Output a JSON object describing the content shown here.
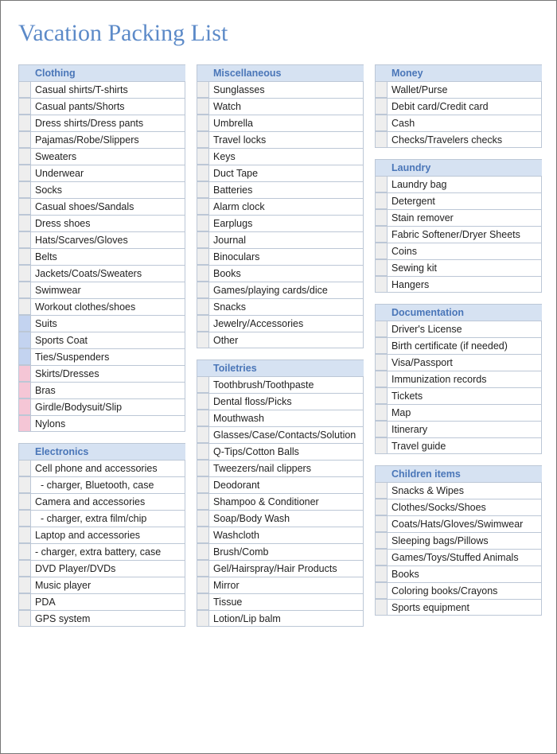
{
  "title": "Vacation Packing List",
  "columns": [
    [
      {
        "header": "Clothing",
        "items": [
          {
            "label": "Casual shirts/T-shirts",
            "color": "grey"
          },
          {
            "label": "Casual pants/Shorts",
            "color": "grey"
          },
          {
            "label": "Dress shirts/Dress pants",
            "color": "grey"
          },
          {
            "label": "Pajamas/Robe/Slippers",
            "color": "grey"
          },
          {
            "label": "Sweaters",
            "color": "grey"
          },
          {
            "label": "Underwear",
            "color": "grey"
          },
          {
            "label": "Socks",
            "color": "grey"
          },
          {
            "label": "Casual shoes/Sandals",
            "color": "grey"
          },
          {
            "label": "Dress shoes",
            "color": "grey"
          },
          {
            "label": "Hats/Scarves/Gloves",
            "color": "grey"
          },
          {
            "label": "Belts",
            "color": "grey"
          },
          {
            "label": "Jackets/Coats/Sweaters",
            "color": "grey"
          },
          {
            "label": "Swimwear",
            "color": "grey"
          },
          {
            "label": "Workout clothes/shoes",
            "color": "grey"
          },
          {
            "label": "Suits",
            "color": "blue"
          },
          {
            "label": "Sports Coat",
            "color": "blue"
          },
          {
            "label": "Ties/Suspenders",
            "color": "blue"
          },
          {
            "label": "Skirts/Dresses",
            "color": "pink"
          },
          {
            "label": "Bras",
            "color": "pink"
          },
          {
            "label": "Girdle/Bodysuit/Slip",
            "color": "pink"
          },
          {
            "label": "Nylons",
            "color": "pink"
          }
        ]
      },
      {
        "header": "Electronics",
        "items": [
          {
            "label": "Cell phone and accessories",
            "color": "grey"
          },
          {
            "label": "  - charger, Bluetooth, case",
            "color": "grey"
          },
          {
            "label": "Camera and accessories",
            "color": "grey"
          },
          {
            "label": "  - charger, extra film/chip",
            "color": "grey"
          },
          {
            "label": "Laptop and accessories",
            "color": "grey"
          },
          {
            "label": "- charger, extra battery, case",
            "color": "grey"
          },
          {
            "label": "DVD Player/DVDs",
            "color": "grey"
          },
          {
            "label": "Music player",
            "color": "grey"
          },
          {
            "label": "PDA",
            "color": "grey"
          },
          {
            "label": "GPS system",
            "color": "grey"
          }
        ]
      }
    ],
    [
      {
        "header": "Miscellaneous",
        "items": [
          {
            "label": "Sunglasses",
            "color": "grey"
          },
          {
            "label": "Watch",
            "color": "grey"
          },
          {
            "label": "Umbrella",
            "color": "grey"
          },
          {
            "label": "Travel locks",
            "color": "grey"
          },
          {
            "label": "Keys",
            "color": "grey"
          },
          {
            "label": "Duct Tape",
            "color": "grey"
          },
          {
            "label": "Batteries",
            "color": "grey"
          },
          {
            "label": "Alarm clock",
            "color": "grey"
          },
          {
            "label": "Earplugs",
            "color": "grey"
          },
          {
            "label": "Journal",
            "color": "grey"
          },
          {
            "label": "Binoculars",
            "color": "grey"
          },
          {
            "label": "Books",
            "color": "grey"
          },
          {
            "label": "Games/playing cards/dice",
            "color": "grey"
          },
          {
            "label": "Snacks",
            "color": "grey"
          },
          {
            "label": "Jewelry/Accessories",
            "color": "grey"
          },
          {
            "label": "Other",
            "color": "grey"
          }
        ]
      },
      {
        "header": "Toiletries",
        "items": [
          {
            "label": "Toothbrush/Toothpaste",
            "color": "grey"
          },
          {
            "label": "Dental floss/Picks",
            "color": "grey"
          },
          {
            "label": "Mouthwash",
            "color": "grey"
          },
          {
            "label": "Glasses/Case/Contacts/Solution",
            "color": "grey"
          },
          {
            "label": "Q-Tips/Cotton Balls",
            "color": "grey"
          },
          {
            "label": "Tweezers/nail clippers",
            "color": "grey"
          },
          {
            "label": "Deodorant",
            "color": "grey"
          },
          {
            "label": "Shampoo & Conditioner",
            "color": "grey"
          },
          {
            "label": "Soap/Body Wash",
            "color": "grey"
          },
          {
            "label": "Washcloth",
            "color": "grey"
          },
          {
            "label": "Brush/Comb",
            "color": "grey"
          },
          {
            "label": "Gel/Hairspray/Hair Products",
            "color": "grey"
          },
          {
            "label": "Mirror",
            "color": "grey"
          },
          {
            "label": "Tissue",
            "color": "grey"
          },
          {
            "label": "Lotion/Lip balm",
            "color": "grey"
          }
        ]
      }
    ],
    [
      {
        "header": "Money",
        "items": [
          {
            "label": "Wallet/Purse",
            "color": "grey"
          },
          {
            "label": "Debit card/Credit card",
            "color": "grey"
          },
          {
            "label": "Cash",
            "color": "grey"
          },
          {
            "label": "Checks/Travelers checks",
            "color": "grey"
          }
        ]
      },
      {
        "header": "Laundry",
        "items": [
          {
            "label": "Laundry bag",
            "color": "grey"
          },
          {
            "label": "Detergent",
            "color": "grey"
          },
          {
            "label": "Stain remover",
            "color": "grey"
          },
          {
            "label": "Fabric Softener/Dryer Sheets",
            "color": "grey"
          },
          {
            "label": "Coins",
            "color": "grey"
          },
          {
            "label": "Sewing kit",
            "color": "grey"
          },
          {
            "label": "Hangers",
            "color": "grey"
          }
        ]
      },
      {
        "header": "Documentation",
        "items": [
          {
            "label": "Driver's License",
            "color": "grey"
          },
          {
            "label": "Birth certificate (if needed)",
            "color": "grey"
          },
          {
            "label": "Visa/Passport",
            "color": "grey"
          },
          {
            "label": "Immunization records",
            "color": "grey"
          },
          {
            "label": "Tickets",
            "color": "grey"
          },
          {
            "label": "Map",
            "color": "grey"
          },
          {
            "label": "Itinerary",
            "color": "grey"
          },
          {
            "label": "Travel guide",
            "color": "grey"
          }
        ]
      },
      {
        "header": "Children items",
        "items": [
          {
            "label": "Snacks & Wipes",
            "color": "grey"
          },
          {
            "label": "Clothes/Socks/Shoes",
            "color": "grey"
          },
          {
            "label": "Coats/Hats/Gloves/Swimwear",
            "color": "grey"
          },
          {
            "label": "Sleeping bags/Pillows",
            "color": "grey"
          },
          {
            "label": "Games/Toys/Stuffed Animals",
            "color": "grey"
          },
          {
            "label": "Books",
            "color": "grey"
          },
          {
            "label": "Coloring books/Crayons",
            "color": "grey"
          },
          {
            "label": "Sports equipment",
            "color": "grey"
          }
        ]
      }
    ]
  ]
}
